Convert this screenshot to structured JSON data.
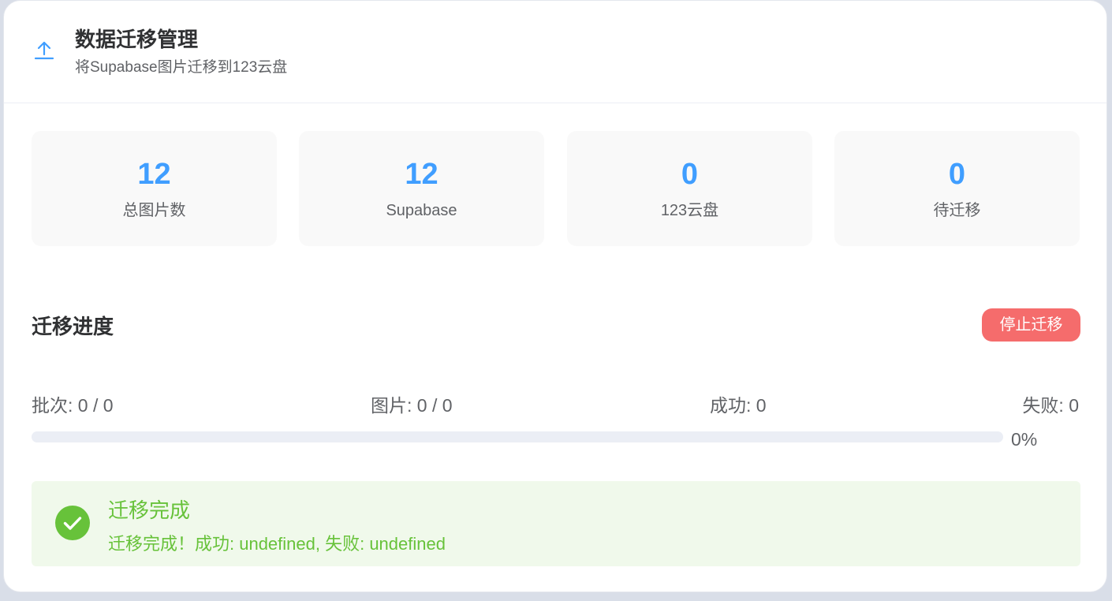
{
  "header": {
    "title": "数据迁移管理",
    "subtitle": "将Supabase图片迁移到123云盘",
    "icon": "upload-icon"
  },
  "stats": [
    {
      "value": "12",
      "label": "总图片数"
    },
    {
      "value": "12",
      "label": "Supabase"
    },
    {
      "value": "0",
      "label": "123云盘"
    },
    {
      "value": "0",
      "label": "待迁移"
    }
  ],
  "progress": {
    "section_title": "迁移进度",
    "stop_button_label": "停止迁移",
    "batch_label": "批次:",
    "batch_value": "0 / 0",
    "images_label": "图片:",
    "images_value": "0 / 0",
    "success_label": "成功:",
    "success_value": "0",
    "failed_label": "失败:",
    "failed_value": "0",
    "percent": 0,
    "percent_text": "0%"
  },
  "alert": {
    "type": "success",
    "icon": "check-circle-icon",
    "title": "迁移完成",
    "description": "迁移完成！成功: undefined, 失败: undefined"
  },
  "colors": {
    "accent": "#409eff",
    "danger": "#f56c6c",
    "success": "#67c23a",
    "success_bg": "#f0f9eb"
  }
}
